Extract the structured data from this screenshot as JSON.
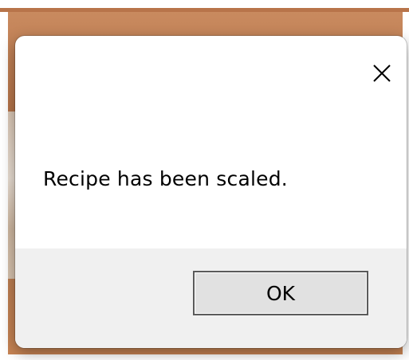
{
  "dialog": {
    "message": "Recipe has been scaled.",
    "ok_label": "OK",
    "close_icon": "close-icon"
  },
  "colors": {
    "dialog_background": "#ffffff",
    "footer_background": "#f0f0f0",
    "button_background": "#e1e1e1",
    "button_border": "#5a5a5a",
    "backdrop_accent": "#b8744a"
  }
}
